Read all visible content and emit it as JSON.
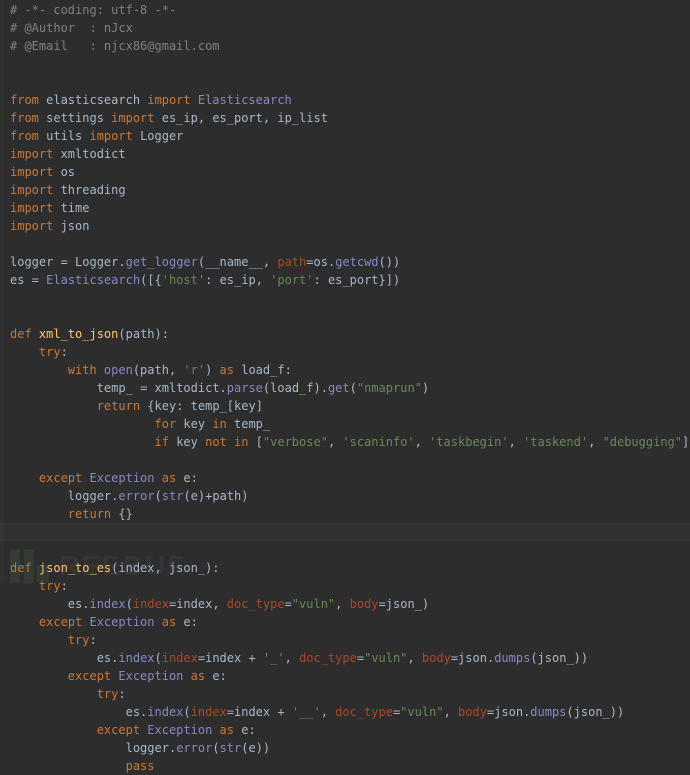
{
  "code": {
    "lines": [
      [
        [
          "comment",
          "# -*- coding: utf-8 -*-"
        ]
      ],
      [
        [
          "comment",
          "# @Author  : nJcx"
        ]
      ],
      [
        [
          "comment",
          "# @Email   : njcx86@gmail.com"
        ]
      ],
      [
        [
          "plain",
          ""
        ]
      ],
      [
        [
          "plain",
          ""
        ]
      ],
      [
        [
          "keyword",
          "from "
        ],
        [
          "ident",
          "elasticsearch "
        ],
        [
          "keyword",
          "import "
        ],
        [
          "builtin",
          "Elasticsearch"
        ]
      ],
      [
        [
          "keyword",
          "from "
        ],
        [
          "ident",
          "settings "
        ],
        [
          "keyword",
          "import "
        ],
        [
          "ident",
          "es_ip"
        ],
        [
          "punct",
          ", "
        ],
        [
          "ident",
          "es_port"
        ],
        [
          "punct",
          ", "
        ],
        [
          "ident",
          "ip_list"
        ]
      ],
      [
        [
          "keyword",
          "from "
        ],
        [
          "ident",
          "utils "
        ],
        [
          "keyword",
          "import "
        ],
        [
          "ident",
          "Logger"
        ]
      ],
      [
        [
          "keyword",
          "import "
        ],
        [
          "ident",
          "xmltodict"
        ]
      ],
      [
        [
          "keyword",
          "import "
        ],
        [
          "ident",
          "os"
        ]
      ],
      [
        [
          "keyword",
          "import "
        ],
        [
          "ident",
          "threading"
        ]
      ],
      [
        [
          "keyword",
          "import "
        ],
        [
          "ident",
          "time"
        ]
      ],
      [
        [
          "keyword",
          "import "
        ],
        [
          "ident",
          "json"
        ]
      ],
      [
        [
          "plain",
          ""
        ]
      ],
      [
        [
          "ident",
          "logger "
        ],
        [
          "punct",
          "= "
        ],
        [
          "ident",
          "Logger"
        ],
        [
          "punct",
          "."
        ],
        [
          "builtin",
          "get_logger"
        ],
        [
          "punct",
          "("
        ],
        [
          "ident",
          "__name__"
        ],
        [
          "punct",
          ", "
        ],
        [
          "kwarg",
          "path"
        ],
        [
          "punct",
          "="
        ],
        [
          "ident",
          "os"
        ],
        [
          "punct",
          "."
        ],
        [
          "builtin",
          "getcwd"
        ],
        [
          "punct",
          "())"
        ]
      ],
      [
        [
          "ident",
          "es "
        ],
        [
          "punct",
          "= "
        ],
        [
          "builtin",
          "Elasticsearch"
        ],
        [
          "punct",
          "([{"
        ],
        [
          "string",
          "'host'"
        ],
        [
          "punct",
          ": "
        ],
        [
          "ident",
          "es_ip"
        ],
        [
          "punct",
          ", "
        ],
        [
          "string",
          "'port'"
        ],
        [
          "punct",
          ": "
        ],
        [
          "ident",
          "es_port"
        ],
        [
          "punct",
          "}])"
        ]
      ],
      [
        [
          "plain",
          ""
        ]
      ],
      [
        [
          "plain",
          ""
        ]
      ],
      [
        [
          "keyword",
          "def "
        ],
        [
          "def",
          "xml_to_json"
        ],
        [
          "punct",
          "(path):"
        ]
      ],
      [
        [
          "plain",
          "    "
        ],
        [
          "keyword",
          "try"
        ],
        [
          "punct",
          ":"
        ]
      ],
      [
        [
          "plain",
          "        "
        ],
        [
          "keyword",
          "with "
        ],
        [
          "builtin",
          "open"
        ],
        [
          "punct",
          "(path, "
        ],
        [
          "string",
          "'r'"
        ],
        [
          "punct",
          ") "
        ],
        [
          "keyword",
          "as "
        ],
        [
          "ident",
          "load_f"
        ],
        [
          "punct",
          ":"
        ]
      ],
      [
        [
          "plain",
          "            "
        ],
        [
          "ident",
          "temp_ "
        ],
        [
          "punct",
          "= "
        ],
        [
          "ident",
          "xmltodict"
        ],
        [
          "punct",
          "."
        ],
        [
          "builtin",
          "parse"
        ],
        [
          "punct",
          "("
        ],
        [
          "ident",
          "load_f"
        ],
        [
          "punct",
          ")."
        ],
        [
          "builtin",
          "get"
        ],
        [
          "punct",
          "("
        ],
        [
          "string",
          "\"nmaprun\""
        ],
        [
          "punct",
          ")"
        ]
      ],
      [
        [
          "plain",
          "            "
        ],
        [
          "keyword",
          "return "
        ],
        [
          "punct",
          "{"
        ],
        [
          "ident",
          "key"
        ],
        [
          "punct",
          ": "
        ],
        [
          "ident",
          "temp_"
        ],
        [
          "punct",
          "["
        ],
        [
          "ident",
          "key"
        ],
        [
          "punct",
          "]"
        ]
      ],
      [
        [
          "plain",
          "                    "
        ],
        [
          "keyword",
          "for "
        ],
        [
          "ident",
          "key "
        ],
        [
          "keyword",
          "in "
        ],
        [
          "ident",
          "temp_"
        ]
      ],
      [
        [
          "plain",
          "                    "
        ],
        [
          "keyword",
          "if "
        ],
        [
          "ident",
          "key "
        ],
        [
          "keyword",
          "not in "
        ],
        [
          "punct",
          "["
        ],
        [
          "string",
          "\"verbose\""
        ],
        [
          "punct",
          ", "
        ],
        [
          "string",
          "'scaninfo'"
        ],
        [
          "punct",
          ", "
        ],
        [
          "string",
          "'taskbegin'"
        ],
        [
          "punct",
          ", "
        ],
        [
          "string",
          "'taskend'"
        ],
        [
          "punct",
          ", "
        ],
        [
          "string",
          "\"debugging\""
        ],
        [
          "punct",
          "]}"
        ]
      ],
      [
        [
          "plain",
          ""
        ]
      ],
      [
        [
          "plain",
          "    "
        ],
        [
          "keyword",
          "except "
        ],
        [
          "builtin",
          "Exception "
        ],
        [
          "keyword",
          "as "
        ],
        [
          "ident",
          "e"
        ],
        [
          "punct",
          ":"
        ]
      ],
      [
        [
          "plain",
          "        "
        ],
        [
          "ident",
          "logger"
        ],
        [
          "punct",
          "."
        ],
        [
          "builtin",
          "error"
        ],
        [
          "punct",
          "("
        ],
        [
          "builtin",
          "str"
        ],
        [
          "punct",
          "("
        ],
        [
          "ident",
          "e"
        ],
        [
          "punct",
          ")+path)"
        ]
      ],
      [
        [
          "plain",
          "        "
        ],
        [
          "keyword",
          "return "
        ],
        [
          "punct",
          "{}"
        ]
      ],
      [
        [
          "plain",
          ""
        ]
      ],
      [
        [
          "plain",
          ""
        ]
      ],
      [
        [
          "keyword",
          "def "
        ],
        [
          "def",
          "json_to_es"
        ],
        [
          "punct",
          "(index, json_):"
        ]
      ],
      [
        [
          "plain",
          "    "
        ],
        [
          "keyword",
          "try"
        ],
        [
          "punct",
          ":"
        ]
      ],
      [
        [
          "plain",
          "        "
        ],
        [
          "ident",
          "es"
        ],
        [
          "punct",
          "."
        ],
        [
          "builtin",
          "index"
        ],
        [
          "punct",
          "("
        ],
        [
          "kwarg",
          "index"
        ],
        [
          "punct",
          "="
        ],
        [
          "ident",
          "index"
        ],
        [
          "punct",
          ", "
        ],
        [
          "kwarg",
          "doc_type"
        ],
        [
          "punct",
          "="
        ],
        [
          "string",
          "\"vuln\""
        ],
        [
          "punct",
          ", "
        ],
        [
          "kwarg",
          "body"
        ],
        [
          "punct",
          "="
        ],
        [
          "ident",
          "json_"
        ],
        [
          "punct",
          ")"
        ]
      ],
      [
        [
          "plain",
          "    "
        ],
        [
          "keyword",
          "except "
        ],
        [
          "builtin",
          "Exception "
        ],
        [
          "keyword",
          "as "
        ],
        [
          "ident",
          "e"
        ],
        [
          "punct",
          ":"
        ]
      ],
      [
        [
          "plain",
          "        "
        ],
        [
          "keyword",
          "try"
        ],
        [
          "punct",
          ":"
        ]
      ],
      [
        [
          "plain",
          "            "
        ],
        [
          "ident",
          "es"
        ],
        [
          "punct",
          "."
        ],
        [
          "builtin",
          "index"
        ],
        [
          "punct",
          "("
        ],
        [
          "kwarg",
          "index"
        ],
        [
          "punct",
          "="
        ],
        [
          "ident",
          "index "
        ],
        [
          "punct",
          "+ "
        ],
        [
          "string",
          "'_'"
        ],
        [
          "punct",
          ", "
        ],
        [
          "kwarg",
          "doc_type"
        ],
        [
          "punct",
          "="
        ],
        [
          "string",
          "\"vuln\""
        ],
        [
          "punct",
          ", "
        ],
        [
          "kwarg",
          "body"
        ],
        [
          "punct",
          "="
        ],
        [
          "ident",
          "json"
        ],
        [
          "punct",
          "."
        ],
        [
          "builtin",
          "dumps"
        ],
        [
          "punct",
          "("
        ],
        [
          "ident",
          "json_"
        ],
        [
          "punct",
          "))"
        ]
      ],
      [
        [
          "plain",
          "        "
        ],
        [
          "keyword",
          "except "
        ],
        [
          "builtin",
          "Exception "
        ],
        [
          "keyword",
          "as "
        ],
        [
          "ident",
          "e"
        ],
        [
          "punct",
          ":"
        ]
      ],
      [
        [
          "plain",
          "            "
        ],
        [
          "keyword",
          "try"
        ],
        [
          "punct",
          ":"
        ]
      ],
      [
        [
          "plain",
          "                "
        ],
        [
          "ident",
          "es"
        ],
        [
          "punct",
          "."
        ],
        [
          "builtin",
          "index"
        ],
        [
          "punct",
          "("
        ],
        [
          "kwarg",
          "index"
        ],
        [
          "punct",
          "="
        ],
        [
          "ident",
          "index "
        ],
        [
          "punct",
          "+ "
        ],
        [
          "string",
          "'__'"
        ],
        [
          "punct",
          ", "
        ],
        [
          "kwarg",
          "doc_type"
        ],
        [
          "punct",
          "="
        ],
        [
          "string",
          "\"vuln\""
        ],
        [
          "punct",
          ", "
        ],
        [
          "kwarg",
          "body"
        ],
        [
          "punct",
          "="
        ],
        [
          "ident",
          "json"
        ],
        [
          "punct",
          "."
        ],
        [
          "builtin",
          "dumps"
        ],
        [
          "punct",
          "("
        ],
        [
          "ident",
          "json_"
        ],
        [
          "punct",
          "))"
        ]
      ],
      [
        [
          "plain",
          "            "
        ],
        [
          "keyword",
          "except "
        ],
        [
          "builtin",
          "Exception "
        ],
        [
          "keyword",
          "as "
        ],
        [
          "ident",
          "e"
        ],
        [
          "punct",
          ":"
        ]
      ],
      [
        [
          "plain",
          "                "
        ],
        [
          "ident",
          "logger"
        ],
        [
          "punct",
          "."
        ],
        [
          "builtin",
          "error"
        ],
        [
          "punct",
          "("
        ],
        [
          "builtin",
          "str"
        ],
        [
          "punct",
          "("
        ],
        [
          "ident",
          "e"
        ],
        [
          "punct",
          "))"
        ]
      ],
      [
        [
          "plain",
          "                "
        ],
        [
          "keyword",
          "pass"
        ]
      ]
    ],
    "highlight_line_index": 29
  },
  "token_class_map": {
    "comment": "c-comment",
    "keyword": "c-keyword",
    "builtin": "c-builtin",
    "ident": "c-ident",
    "string": "c-string",
    "kwarg": "c-kwarg",
    "def": "c-def",
    "punct": "c-punct",
    "plain": "c-ident"
  },
  "watermark": {
    "bars": "▌▌▖",
    "text": "REEBUF"
  }
}
